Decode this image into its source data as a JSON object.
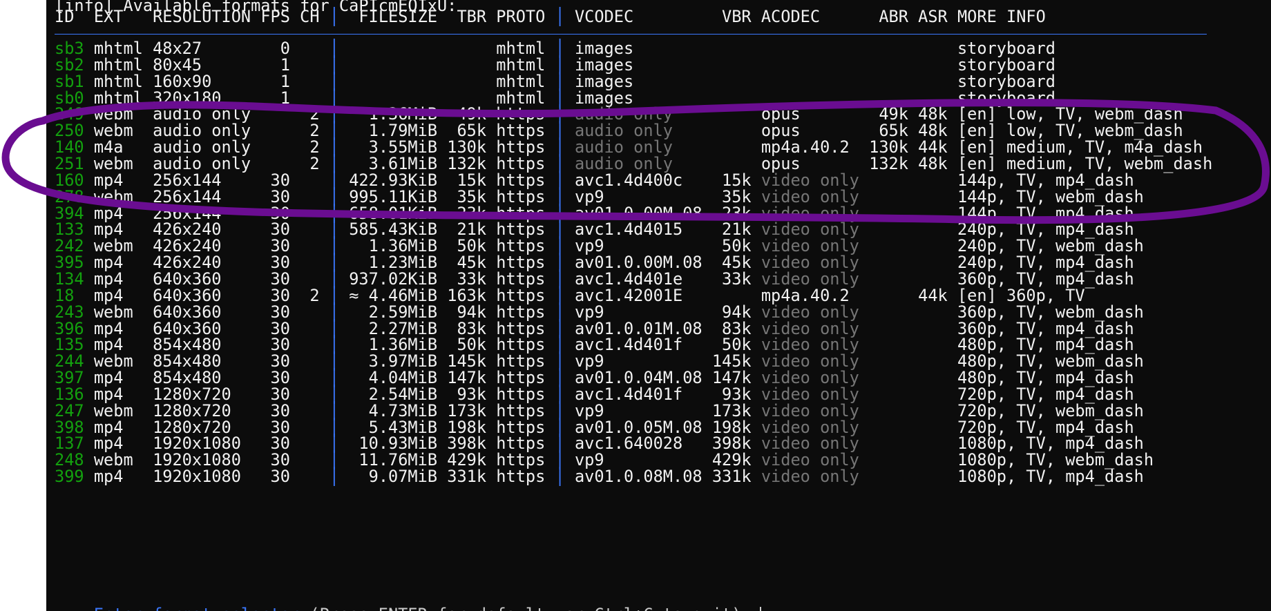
{
  "terminal": {
    "title_line": "[info] Available formats for CaPIcmEQIxU:",
    "header": [
      "ID",
      "EXT",
      "RESOLUTION",
      "FPS",
      "CH",
      "FILESIZE",
      "TBR",
      "PROTO",
      "VCODEC",
      "VBR",
      "ACODEC",
      "ABR",
      "ASR",
      "MORE INFO"
    ],
    "rows": [
      [
        "sb3",
        "mhtml",
        "48x27",
        "0",
        "",
        "",
        "",
        "mhtml",
        "images",
        "",
        "",
        "",
        "",
        "storyboard"
      ],
      [
        "sb2",
        "mhtml",
        "80x45",
        "1",
        "",
        "",
        "",
        "mhtml",
        "images",
        "",
        "",
        "",
        "",
        "storyboard"
      ],
      [
        "sb1",
        "mhtml",
        "160x90",
        "1",
        "",
        "",
        "",
        "mhtml",
        "images",
        "",
        "",
        "",
        "",
        "storyboard"
      ],
      [
        "sb0",
        "mhtml",
        "320x180",
        "1",
        "",
        "",
        "",
        "mhtml",
        "images",
        "",
        "",
        "",
        "",
        "storyboard"
      ],
      [
        "249",
        "webm",
        "audio only",
        "",
        "2",
        "1.36MiB",
        "49k",
        "https",
        "audio only",
        "",
        "opus",
        "49k",
        "48k",
        "[en] low, TV, webm_dash"
      ],
      [
        "250",
        "webm",
        "audio only",
        "",
        "2",
        "1.79MiB",
        "65k",
        "https",
        "audio only",
        "",
        "opus",
        "65k",
        "48k",
        "[en] low, TV, webm_dash"
      ],
      [
        "140",
        "m4a",
        "audio only",
        "",
        "2",
        "3.55MiB",
        "130k",
        "https",
        "audio only",
        "",
        "mp4a.40.2",
        "130k",
        "44k",
        "[en] medium, TV, m4a_dash"
      ],
      [
        "251",
        "webm",
        "audio only",
        "",
        "2",
        "3.61MiB",
        "132k",
        "https",
        "audio only",
        "",
        "opus",
        "132k",
        "48k",
        "[en] medium, TV, webm_dash"
      ],
      [
        "160",
        "mp4",
        "256x144",
        "30",
        "",
        "422.93KiB",
        "15k",
        "https",
        "avc1.4d400c",
        "15k",
        "video only",
        "",
        "",
        "144p, TV, mp4_dash"
      ],
      [
        "278",
        "webm",
        "256x144",
        "30",
        "",
        "995.11KiB",
        "35k",
        "https",
        "vp9",
        "35k",
        "video only",
        "",
        "",
        "144p, TV, webm_dash"
      ],
      [
        "394",
        "mp4",
        "256x144",
        "30",
        "",
        "658.01KiB",
        "23k",
        "https",
        "av01.0.00M.08",
        "23k",
        "video only",
        "",
        "",
        "144p, TV, mp4_dash"
      ],
      [
        "133",
        "mp4",
        "426x240",
        "30",
        "",
        "585.43KiB",
        "21k",
        "https",
        "avc1.4d4015",
        "21k",
        "video only",
        "",
        "",
        "240p, TV, mp4_dash"
      ],
      [
        "242",
        "webm",
        "426x240",
        "30",
        "",
        "1.36MiB",
        "50k",
        "https",
        "vp9",
        "50k",
        "video only",
        "",
        "",
        "240p, TV, webm_dash"
      ],
      [
        "395",
        "mp4",
        "426x240",
        "30",
        "",
        "1.23MiB",
        "45k",
        "https",
        "av01.0.00M.08",
        "45k",
        "video only",
        "",
        "",
        "240p, TV, mp4_dash"
      ],
      [
        "134",
        "mp4",
        "640x360",
        "30",
        "",
        "937.02KiB",
        "33k",
        "https",
        "avc1.4d401e",
        "33k",
        "video only",
        "",
        "",
        "360p, TV, mp4_dash"
      ],
      [
        "18",
        "mp4",
        "640x360",
        "30",
        "2",
        "≈ 4.46MiB",
        "163k",
        "https",
        "avc1.42001E",
        "",
        "mp4a.40.2",
        "",
        "44k",
        "[en] 360p, TV"
      ],
      [
        "243",
        "webm",
        "640x360",
        "30",
        "",
        "2.59MiB",
        "94k",
        "https",
        "vp9",
        "94k",
        "video only",
        "",
        "",
        "360p, TV, webm_dash"
      ],
      [
        "396",
        "mp4",
        "640x360",
        "30",
        "",
        "2.27MiB",
        "83k",
        "https",
        "av01.0.01M.08",
        "83k",
        "video only",
        "",
        "",
        "360p, TV, mp4_dash"
      ],
      [
        "135",
        "mp4",
        "854x480",
        "30",
        "",
        "1.36MiB",
        "50k",
        "https",
        "avc1.4d401f",
        "50k",
        "video only",
        "",
        "",
        "480p, TV, mp4_dash"
      ],
      [
        "244",
        "webm",
        "854x480",
        "30",
        "",
        "3.97MiB",
        "145k",
        "https",
        "vp9",
        "145k",
        "video only",
        "",
        "",
        "480p, TV, webm_dash"
      ],
      [
        "397",
        "mp4",
        "854x480",
        "30",
        "",
        "4.04MiB",
        "147k",
        "https",
        "av01.0.04M.08",
        "147k",
        "video only",
        "",
        "",
        "480p, TV, mp4_dash"
      ],
      [
        "136",
        "mp4",
        "1280x720",
        "30",
        "",
        "2.54MiB",
        "93k",
        "https",
        "avc1.4d401f",
        "93k",
        "video only",
        "",
        "",
        "720p, TV, mp4_dash"
      ],
      [
        "247",
        "webm",
        "1280x720",
        "30",
        "",
        "4.73MiB",
        "173k",
        "https",
        "vp9",
        "173k",
        "video only",
        "",
        "",
        "720p, TV, webm_dash"
      ],
      [
        "398",
        "mp4",
        "1280x720",
        "30",
        "",
        "5.43MiB",
        "198k",
        "https",
        "av01.0.05M.08",
        "198k",
        "video only",
        "",
        "",
        "720p, TV, mp4_dash"
      ],
      [
        "137",
        "mp4",
        "1920x1080",
        "30",
        "",
        "10.93MiB",
        "398k",
        "https",
        "avc1.640028",
        "398k",
        "video only",
        "",
        "",
        "1080p, TV, mp4_dash"
      ],
      [
        "248",
        "webm",
        "1920x1080",
        "30",
        "",
        "11.76MiB",
        "429k",
        "https",
        "vp9",
        "429k",
        "video only",
        "",
        "",
        "1080p, TV, webm_dash"
      ],
      [
        "399",
        "mp4",
        "1920x1080",
        "30",
        "",
        "9.07MiB",
        "331k",
        "https",
        "av01.0.08M.08",
        "331k",
        "video only",
        "",
        "",
        "1080p, TV, mp4_dash"
      ]
    ],
    "prompt": {
      "label": "Enter format selector",
      "hint": " (Press ENTER for default, or Ctrl+C to quit):"
    }
  },
  "colors": {
    "background": "#0c0c0c",
    "id_green": "#13a10e",
    "separator_blue": "#3b78ff",
    "dim_gray": "#767676",
    "annotation_purple": "#6a0d91"
  },
  "annotation": {
    "shape": "freehand ellipse",
    "encircles_rows": [
      "249",
      "250",
      "140",
      "251"
    ]
  }
}
